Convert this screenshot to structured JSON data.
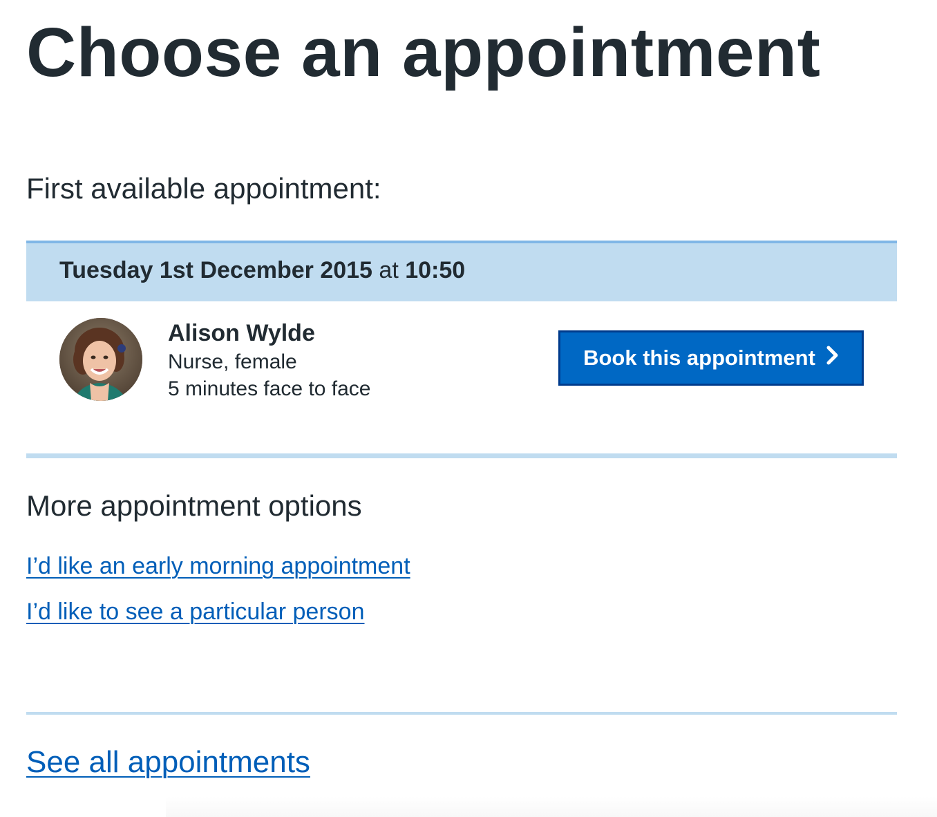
{
  "page": {
    "title": "Choose an appointment"
  },
  "first_available": {
    "label": "First available appointment:",
    "date": "Tuesday 1st December 2015",
    "connector": "at",
    "time": "10:50",
    "clinician": {
      "name": "Alison Wylde",
      "role": "Nurse, female",
      "duration": "5 minutes face to face",
      "avatar_icon": "person-photo"
    },
    "book_button": {
      "label": "Book this appointment",
      "icon": "chevron-right-icon"
    }
  },
  "more_options": {
    "heading": "More appointment options",
    "links": [
      {
        "label": "I’d like an early morning appointment"
      },
      {
        "label": "I’d like to see a particular person"
      }
    ]
  },
  "footer": {
    "see_all_label": "See all appointments"
  },
  "colors": {
    "text": "#212b32",
    "link": "#005eb8",
    "panel": "#c0dcf0",
    "panel_border": "#80b6e6",
    "button": "#0068c4",
    "button_border": "#003b8c"
  }
}
